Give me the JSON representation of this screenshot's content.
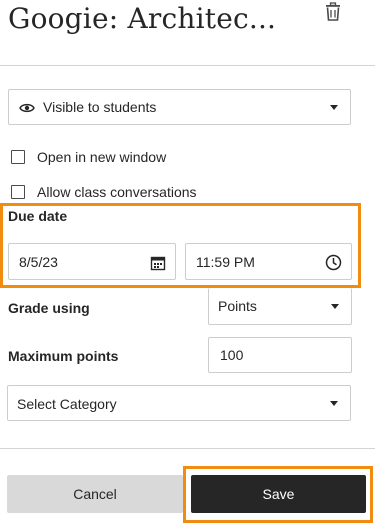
{
  "header": {
    "title": "Googie: Architec..."
  },
  "visibility": {
    "selected": "Visible to students",
    "icon": "eye-icon"
  },
  "options": {
    "open_new_window": {
      "label": "Open in new window",
      "checked": false
    },
    "allow_conversations": {
      "label": "Allow class conversations",
      "checked": false
    }
  },
  "due": {
    "label": "Due date",
    "date": "8/5/23",
    "time": "11:59 PM"
  },
  "grade": {
    "label": "Grade using",
    "selected": "Points"
  },
  "max_points": {
    "label": "Maximum points",
    "value": "100"
  },
  "category": {
    "selected": "Select Category"
  },
  "footer": {
    "cancel_label": "Cancel",
    "save_label": "Save"
  },
  "colors": {
    "highlight": "#f28c0f",
    "save_bg": "#262626",
    "cancel_bg": "#d9d9d9"
  }
}
